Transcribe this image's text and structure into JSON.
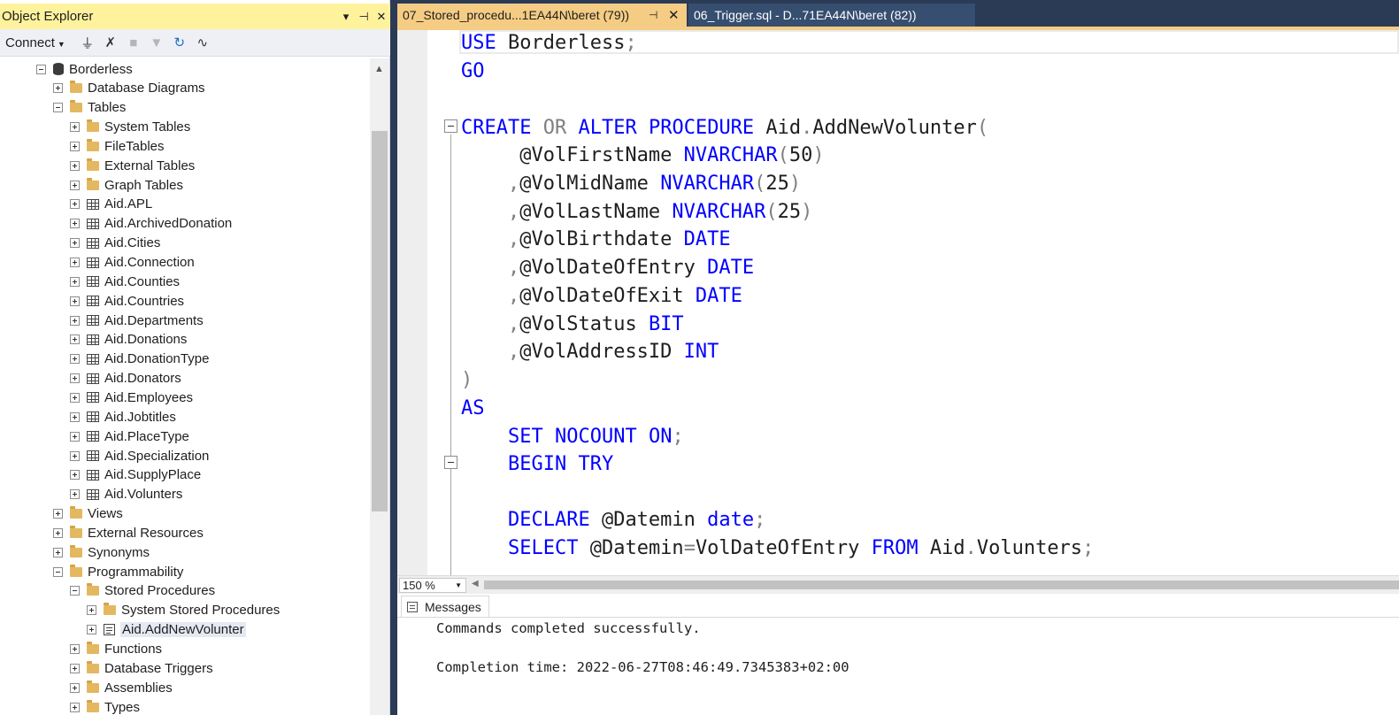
{
  "object_explorer": {
    "title": "Object Explorer",
    "pin_icon": "pin-icon",
    "dropdown_icon": "dropdown-icon",
    "close_icon": "close-icon",
    "toolbar": {
      "connect_label": "Connect",
      "icons": [
        "connect-plug-icon",
        "disconnect-icon",
        "stop-icon",
        "filter-icon",
        "refresh-icon",
        "activity-monitor-icon"
      ]
    },
    "tree": [
      {
        "label": "Borderless",
        "icon": "database-icon",
        "expander": "minus"
      },
      {
        "label": "Database Diagrams",
        "icon": "folder-icon",
        "expander": "plus"
      },
      {
        "label": "Tables",
        "icon": "folder-icon",
        "expander": "minus"
      },
      {
        "label": "System Tables",
        "icon": "folder-icon",
        "expander": "plus"
      },
      {
        "label": "FileTables",
        "icon": "folder-icon",
        "expander": "plus"
      },
      {
        "label": "External Tables",
        "icon": "folder-icon",
        "expander": "plus"
      },
      {
        "label": "Graph Tables",
        "icon": "folder-icon",
        "expander": "plus"
      },
      {
        "label": "Aid.APL",
        "icon": "table-icon",
        "expander": "plus"
      },
      {
        "label": "Aid.ArchivedDonation",
        "icon": "table-icon",
        "expander": "plus"
      },
      {
        "label": "Aid.Cities",
        "icon": "table-icon",
        "expander": "plus"
      },
      {
        "label": "Aid.Connection",
        "icon": "table-icon",
        "expander": "plus"
      },
      {
        "label": "Aid.Counties",
        "icon": "table-icon",
        "expander": "plus"
      },
      {
        "label": "Aid.Countries",
        "icon": "table-icon",
        "expander": "plus"
      },
      {
        "label": "Aid.Departments",
        "icon": "table-icon",
        "expander": "plus"
      },
      {
        "label": "Aid.Donations",
        "icon": "table-icon",
        "expander": "plus"
      },
      {
        "label": "Aid.DonationType",
        "icon": "table-icon",
        "expander": "plus"
      },
      {
        "label": "Aid.Donators",
        "icon": "table-icon",
        "expander": "plus"
      },
      {
        "label": "Aid.Employees",
        "icon": "table-icon",
        "expander": "plus"
      },
      {
        "label": "Aid.Jobtitles",
        "icon": "table-icon",
        "expander": "plus"
      },
      {
        "label": "Aid.PlaceType",
        "icon": "table-icon",
        "expander": "plus"
      },
      {
        "label": "Aid.Specialization",
        "icon": "table-icon",
        "expander": "plus"
      },
      {
        "label": "Aid.SupplyPlace",
        "icon": "table-icon",
        "expander": "plus"
      },
      {
        "label": "Aid.Volunters",
        "icon": "table-icon",
        "expander": "plus"
      },
      {
        "label": "Views",
        "icon": "folder-icon",
        "expander": "plus"
      },
      {
        "label": "External Resources",
        "icon": "folder-icon",
        "expander": "plus"
      },
      {
        "label": "Synonyms",
        "icon": "folder-icon",
        "expander": "plus"
      },
      {
        "label": "Programmability",
        "icon": "folder-icon",
        "expander": "minus"
      },
      {
        "label": "Stored Procedures",
        "icon": "folder-icon",
        "expander": "minus"
      },
      {
        "label": "System Stored Procedures",
        "icon": "folder-icon",
        "expander": "plus"
      },
      {
        "label": "Aid.AddNewVolunter",
        "icon": "stored-procedure-icon",
        "expander": "plus",
        "selected": true
      },
      {
        "label": "Functions",
        "icon": "folder-icon",
        "expander": "plus"
      },
      {
        "label": "Database Triggers",
        "icon": "folder-icon",
        "expander": "plus"
      },
      {
        "label": "Assemblies",
        "icon": "folder-icon",
        "expander": "plus"
      },
      {
        "label": "Types",
        "icon": "folder-icon",
        "expander": "plus"
      }
    ]
  },
  "tabs": [
    {
      "label": "07_Stored_procedu...1EA44N\\beret (79))",
      "active": true
    },
    {
      "label": "06_Trigger.sql - D...71EA44N\\beret (82))",
      "active": false
    }
  ],
  "editor": {
    "lines": [
      [
        {
          "t": "USE",
          "c": "kw"
        },
        {
          "t": " Borderless"
        },
        {
          "t": ";",
          "c": "gr"
        }
      ],
      [
        {
          "t": "GO",
          "c": "kw"
        }
      ],
      [],
      [
        {
          "t": "CREATE",
          "c": "kw"
        },
        {
          "t": " "
        },
        {
          "t": "OR",
          "c": "gr"
        },
        {
          "t": " "
        },
        {
          "t": "ALTER",
          "c": "kw"
        },
        {
          "t": " "
        },
        {
          "t": "PROCEDURE",
          "c": "kw"
        },
        {
          "t": " Aid"
        },
        {
          "t": ".",
          "c": "gr"
        },
        {
          "t": "AddNewVolunter"
        },
        {
          "t": "(",
          "c": "gr"
        }
      ],
      [
        {
          "t": "     @VolFirstName "
        },
        {
          "t": "NVARCHAR",
          "c": "kw"
        },
        {
          "t": "(",
          "c": "gr"
        },
        {
          "t": "50"
        },
        {
          "t": ")",
          "c": "gr"
        }
      ],
      [
        {
          "t": "    "
        },
        {
          "t": ",",
          "c": "gr"
        },
        {
          "t": "@VolMidName "
        },
        {
          "t": "NVARCHAR",
          "c": "kw"
        },
        {
          "t": "(",
          "c": "gr"
        },
        {
          "t": "25"
        },
        {
          "t": ")",
          "c": "gr"
        }
      ],
      [
        {
          "t": "    "
        },
        {
          "t": ",",
          "c": "gr"
        },
        {
          "t": "@VolLastName "
        },
        {
          "t": "NVARCHAR",
          "c": "kw"
        },
        {
          "t": "(",
          "c": "gr"
        },
        {
          "t": "25"
        },
        {
          "t": ")",
          "c": "gr"
        }
      ],
      [
        {
          "t": "    "
        },
        {
          "t": ",",
          "c": "gr"
        },
        {
          "t": "@VolBirthdate "
        },
        {
          "t": "DATE",
          "c": "kw"
        }
      ],
      [
        {
          "t": "    "
        },
        {
          "t": ",",
          "c": "gr"
        },
        {
          "t": "@VolDateOfEntry "
        },
        {
          "t": "DATE",
          "c": "kw"
        }
      ],
      [
        {
          "t": "    "
        },
        {
          "t": ",",
          "c": "gr"
        },
        {
          "t": "@VolDateOfExit "
        },
        {
          "t": "DATE",
          "c": "kw"
        }
      ],
      [
        {
          "t": "    "
        },
        {
          "t": ",",
          "c": "gr"
        },
        {
          "t": "@VolStatus "
        },
        {
          "t": "BIT",
          "c": "kw"
        }
      ],
      [
        {
          "t": "    "
        },
        {
          "t": ",",
          "c": "gr"
        },
        {
          "t": "@VolAddressID "
        },
        {
          "t": "INT",
          "c": "kw"
        }
      ],
      [
        {
          "t": ")",
          "c": "gr"
        }
      ],
      [
        {
          "t": "AS",
          "c": "kw"
        }
      ],
      [
        {
          "t": "    "
        },
        {
          "t": "SET",
          "c": "kw"
        },
        {
          "t": " "
        },
        {
          "t": "NOCOUNT",
          "c": "kw"
        },
        {
          "t": " "
        },
        {
          "t": "ON",
          "c": "kw"
        },
        {
          "t": ";",
          "c": "gr"
        }
      ],
      [
        {
          "t": "    "
        },
        {
          "t": "BEGIN",
          "c": "kw"
        },
        {
          "t": " "
        },
        {
          "t": "TRY",
          "c": "kw"
        }
      ],
      [],
      [
        {
          "t": "    "
        },
        {
          "t": "DECLARE",
          "c": "kw"
        },
        {
          "t": " @Datemin "
        },
        {
          "t": "date",
          "c": "kw"
        },
        {
          "t": ";",
          "c": "gr"
        }
      ],
      [
        {
          "t": "    "
        },
        {
          "t": "SELECT",
          "c": "kw"
        },
        {
          "t": " @Datemin"
        },
        {
          "t": "=",
          "c": "gr"
        },
        {
          "t": "VolDateOfEntry "
        },
        {
          "t": "FROM",
          "c": "kw"
        },
        {
          "t": " Aid"
        },
        {
          "t": ".",
          "c": "gr"
        },
        {
          "t": "Volunters"
        },
        {
          "t": ";",
          "c": "gr"
        }
      ]
    ]
  },
  "zoom": {
    "value": "150 %"
  },
  "results": {
    "tab_label": "Messages",
    "lines": [
      "Commands completed successfully.",
      "",
      "Completion time: 2022-06-27T08:46:49.7345383+02:00"
    ]
  }
}
